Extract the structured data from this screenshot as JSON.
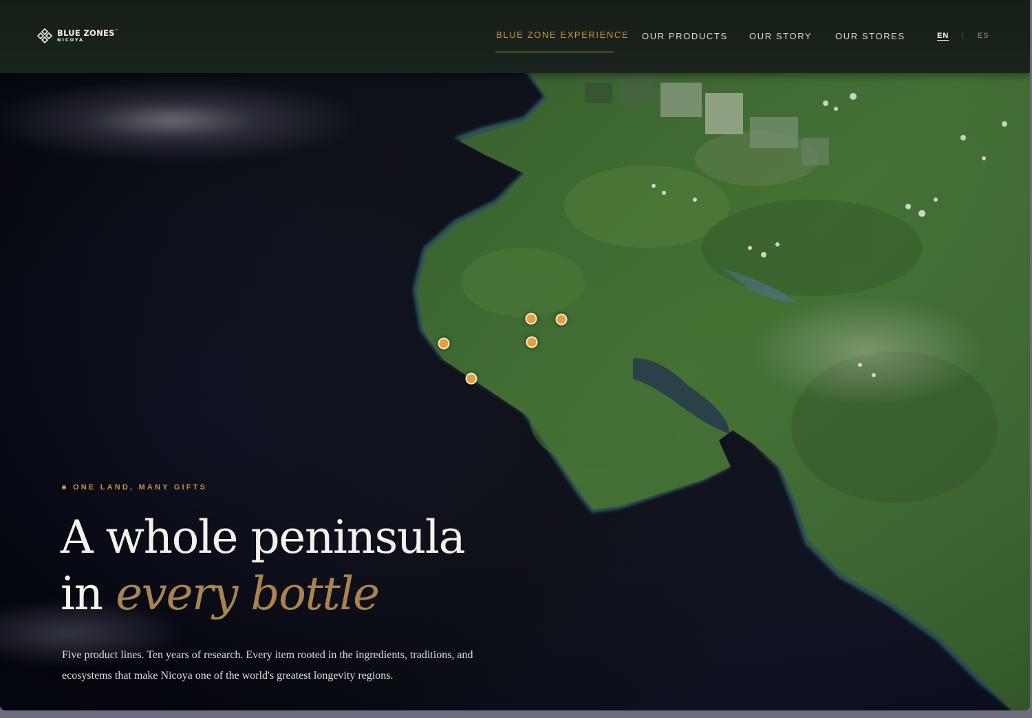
{
  "brand": {
    "name": "BLUE ZONES",
    "trademark": "™",
    "region": "NICOYA"
  },
  "nav": {
    "items": [
      {
        "label": "BLUE ZONE EXPERIENCE",
        "active": true
      },
      {
        "label": "OUR PRODUCTS",
        "active": false
      },
      {
        "label": "OUR STORY",
        "active": false
      },
      {
        "label": "OUR STORES",
        "active": false
      }
    ],
    "languages": [
      {
        "code": "EN",
        "active": true
      },
      {
        "code": "ES",
        "active": false
      }
    ],
    "separator": "|"
  },
  "hero": {
    "eyebrow": "ONE LAND, MANY GIFTS",
    "headline_line1": "A whole peninsula",
    "headline_line2_plain": "in ",
    "headline_line2_accent": "every bottle",
    "body": "Five product lines. Ten years of research. Every item rooted in the ingredients, traditions, and ecosystems that make Nicoya one of the world's greatest longevity regions."
  },
  "map": {
    "marker_count": 5
  },
  "colors": {
    "accent_gold": "#c8943f",
    "header_bg": "#1a241c",
    "ocean": "#04070f",
    "land": "#3e6b2a",
    "marker": "#e3a040"
  }
}
